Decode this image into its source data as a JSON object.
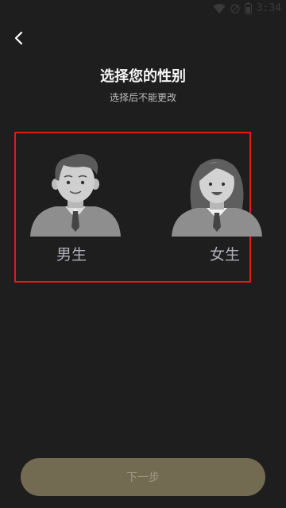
{
  "status_bar": {
    "time": "3:34"
  },
  "header": {
    "title": "选择您的性别",
    "subtitle": "选择后不能更改"
  },
  "gender_options": [
    {
      "label": "男生",
      "icon": "male-avatar-icon"
    },
    {
      "label": "女生",
      "icon": "female-avatar-icon"
    }
  ],
  "footer": {
    "next_label": "下一步"
  },
  "colors": {
    "background": "#1e1e1e",
    "highlight_border": "#e21a1a",
    "button_bg": "#736a52",
    "label": "#b0b0b8"
  }
}
